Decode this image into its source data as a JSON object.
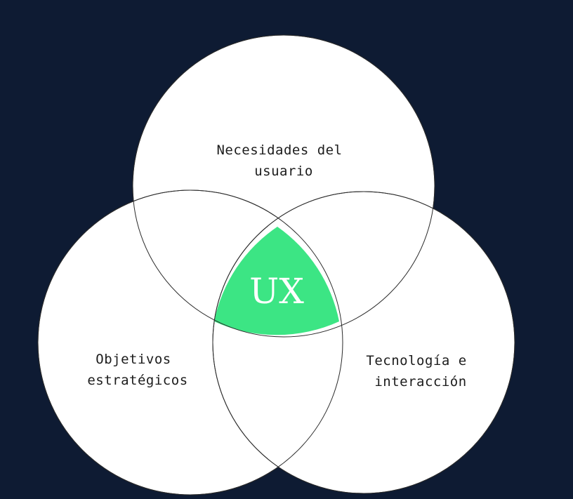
{
  "diagram": {
    "type": "venn",
    "colors": {
      "background": "#0e1b33",
      "circle_fill": "#ffffff",
      "circle_stroke": "#2a2a2a",
      "intersection_fill": "#3ce584",
      "intersection_text": "#ffffff",
      "label_text": "#1c1c1c"
    },
    "sets": [
      {
        "id": "top",
        "label_lines": [
          "Necesidades del",
          "usuario"
        ]
      },
      {
        "id": "left",
        "label_lines": [
          "Objetivos",
          "estratégicos"
        ]
      },
      {
        "id": "right",
        "label_lines": [
          "Tecnología e",
          "interacción"
        ]
      }
    ],
    "intersection": {
      "label": "UX",
      "sets": [
        "top",
        "left",
        "right"
      ]
    }
  }
}
